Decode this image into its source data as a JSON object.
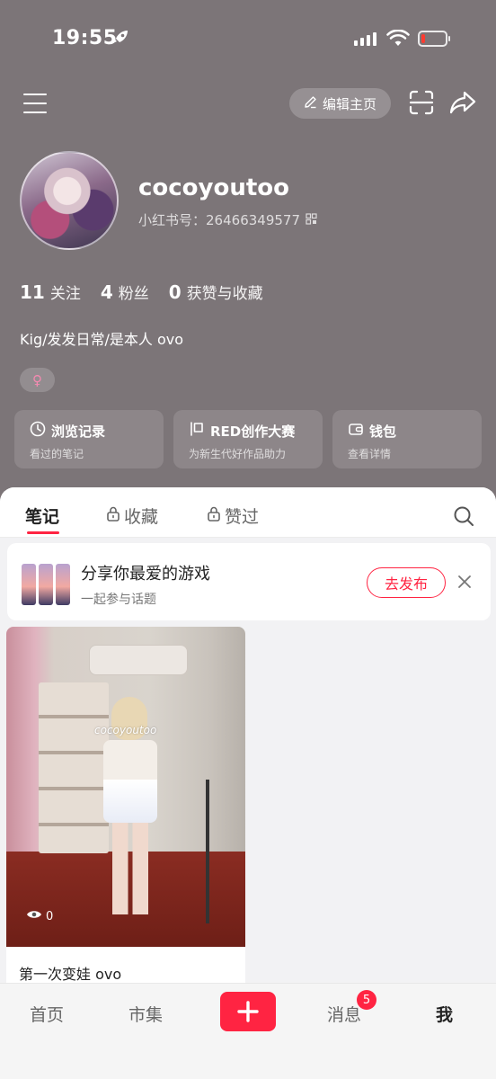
{
  "status_bar": {
    "time": "19:55",
    "battery_level": 0.15,
    "icons": [
      "rocket-icon",
      "signal-icon",
      "wifi-icon",
      "battery-icon"
    ]
  },
  "top_nav": {
    "edit_profile_label": "编辑主页",
    "icons": [
      "menu-icon",
      "pencil-icon",
      "scan-icon",
      "share-icon"
    ]
  },
  "profile": {
    "username": "cocoyoutoo",
    "red_id_prefix": "小红书号：",
    "red_id": "26466349577",
    "bio": "Kig/发发日常/是本人 ovo",
    "gender_symbol": "♀",
    "stats": [
      {
        "num": "11",
        "label": "关注"
      },
      {
        "num": "4",
        "label": "粉丝"
      },
      {
        "num": "0",
        "label": "获赞与收藏"
      }
    ]
  },
  "cards": [
    {
      "title": "浏览记录",
      "subtitle": "看过的笔记",
      "icon": "clock-icon"
    },
    {
      "title": "RED创作大赛",
      "subtitle": "为新生代好作品助力",
      "icon": "flag-icon"
    },
    {
      "title": "钱包",
      "subtitle": "查看详情",
      "icon": "wallet-icon"
    }
  ],
  "tabs": [
    {
      "label": "笔记",
      "locked": false
    },
    {
      "label": "收藏",
      "locked": true
    },
    {
      "label": "赞过",
      "locked": true
    }
  ],
  "banner": {
    "title": "分享你最爱的游戏",
    "subtitle": "一起参与话题",
    "button": "去发布"
  },
  "notes": [
    {
      "title": "第一次变娃 ovo",
      "views": "0",
      "watermark": "cocoyoutoo"
    }
  ],
  "bottom_nav": {
    "items": [
      "首页",
      "市集",
      "消息",
      "我"
    ],
    "message_badge": "5",
    "plus_symbol": "+"
  },
  "colors": {
    "accent": "#ff2442",
    "header_bg": "#7c7578",
    "female_tag": "#f58ab1"
  }
}
